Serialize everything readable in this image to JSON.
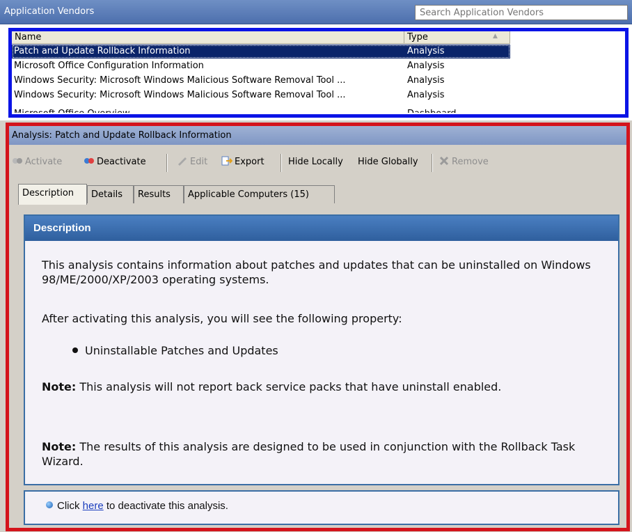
{
  "header": {
    "title": "Application Vendors",
    "search_placeholder": "Search Application Vendors"
  },
  "list": {
    "columns": [
      "Name",
      "Type"
    ],
    "rows": [
      {
        "name": "Patch and Update Rollback Information",
        "type": "Analysis",
        "selected": true
      },
      {
        "name": "Microsoft Office Configuration Information",
        "type": "Analysis"
      },
      {
        "name": "Windows Security: Microsoft Windows Malicious Software Removal Tool ...",
        "type": "Analysis"
      },
      {
        "name": "Windows Security: Microsoft Windows Malicious Software Removal Tool ...",
        "type": "Analysis"
      },
      {
        "name": "Microsoft Office Overview",
        "type": "Dashboard"
      }
    ]
  },
  "analysis": {
    "title": "Analysis: Patch and Update Rollback Information",
    "toolbar": {
      "activate": "Activate",
      "deactivate": "Deactivate",
      "edit": "Edit",
      "export": "Export",
      "hide_locally": "Hide Locally",
      "hide_globally": "Hide Globally",
      "remove": "Remove"
    },
    "tabs": [
      "Description",
      "Details",
      "Results",
      "Applicable Computers (15)"
    ],
    "active_tab": "Description"
  },
  "description": {
    "heading": "Description",
    "p1": "This analysis contains information about patches and updates that can be uninstalled on Windows 98/ME/2000/XP/2003 operating systems.",
    "p2": "After activating this analysis, you will see the following property:",
    "bullet": "Uninstallable Patches and Updates",
    "note_label": "Note:",
    "note1": " This analysis will not report back service packs that have uninstall enabled.",
    "note2": " The results of this analysis are designed to be used in conjunction with the Rollback Task Wizard."
  },
  "footer": {
    "prefix": "Click ",
    "link": "here",
    "suffix": " to deactivate this analysis."
  },
  "colors": {
    "highlight_blue": "#0b14e6",
    "highlight_red": "#d4141c",
    "panel_header": "#2f5f9e"
  }
}
